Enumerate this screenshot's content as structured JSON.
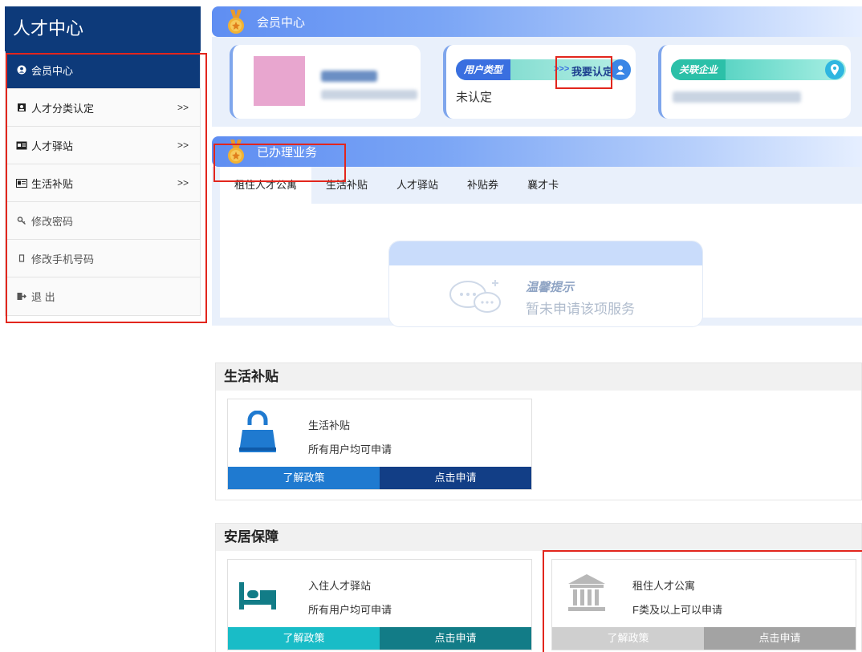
{
  "sidebar": {
    "title": "人才中心",
    "items": [
      {
        "icon": "user-circle-icon",
        "label": "会员中心",
        "arrow": ""
      },
      {
        "icon": "person-badge-icon",
        "label": "人才分类认定",
        "arrow": ">>"
      },
      {
        "icon": "id-card-icon",
        "label": "人才驿站",
        "arrow": ">>"
      },
      {
        "icon": "card-icon",
        "label": "生活补贴",
        "arrow": ">>"
      },
      {
        "icon": "key-icon",
        "label": "修改密码",
        "arrow": ""
      },
      {
        "icon": "phone-icon",
        "label": "修改手机号码",
        "arrow": ""
      },
      {
        "icon": "logout-icon",
        "label": "退 出",
        "arrow": ""
      }
    ]
  },
  "member": {
    "section_title": "会员中心",
    "user_type_label": "用户类型",
    "user_type_arrow": ">>>",
    "certify_link": "我要认定",
    "cert_status": "未认定",
    "company_label": "关联企业"
  },
  "business": {
    "section_title": "已办理业务",
    "tabs": [
      "租住人才公寓",
      "生活补贴",
      "人才驿站",
      "补贴券",
      "襄才卡"
    ],
    "tip_title": "温馨提示",
    "tip_text": "暂未申请该项服务"
  },
  "living": {
    "title": "生活补贴",
    "card": {
      "name": "生活补贴",
      "desc": "所有用户均可申请",
      "btn_policy": "了解政策",
      "btn_apply": "点击申请"
    }
  },
  "housing": {
    "title": "安居保障",
    "cards": [
      {
        "name": "入住人才驿站",
        "desc": "所有用户均可申请",
        "btn_policy": "了解政策",
        "btn_apply": "点击申请"
      },
      {
        "name": "租住人才公寓",
        "desc": "F类及以上可以申请",
        "btn_policy": "了解政策",
        "btn_apply": "点击申请"
      }
    ]
  },
  "colors": {
    "sidebar_bg": "#0d3a7a",
    "annotation_red": "#e2261d",
    "btn_blue": "#1f7ad0",
    "btn_navy": "#123e86",
    "btn_teal": "#19bcc7",
    "btn_dark_teal": "#127c87",
    "btn_gray_light": "#cfcfcf",
    "btn_gray": "#a3a3a3"
  }
}
